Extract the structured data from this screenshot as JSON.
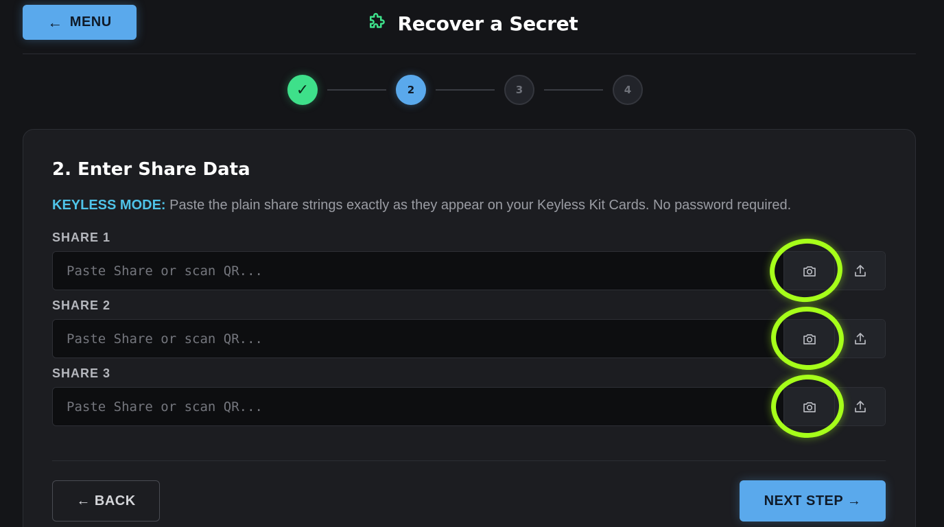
{
  "header": {
    "menu_arrow": "←",
    "menu_label": "MENU",
    "title": "Recover a Secret",
    "title_icon": "puzzle-icon"
  },
  "stepper": {
    "steps": [
      {
        "label": "✓",
        "state": "done"
      },
      {
        "label": "2",
        "state": "active"
      },
      {
        "label": "3",
        "state": "upcoming"
      },
      {
        "label": "4",
        "state": "upcoming"
      }
    ]
  },
  "card": {
    "title": "2. Enter Share Data",
    "mode_tag": "KEYLESS MODE:",
    "mode_text": " Paste the plain share strings exactly as they appear on your Keyless Kit Cards. No password required.",
    "shares": [
      {
        "label": "SHARE 1",
        "placeholder": "Paste Share or scan QR...",
        "value": ""
      },
      {
        "label": "SHARE 2",
        "placeholder": "Paste Share or scan QR...",
        "value": ""
      },
      {
        "label": "SHARE 3",
        "placeholder": "Paste Share or scan QR...",
        "value": ""
      }
    ],
    "back_label": "← BACK",
    "next_label": "NEXT STEP →"
  },
  "colors": {
    "accent": "#5aa9ec",
    "success": "#3ee08a",
    "mode_tag": "#4fc3e8",
    "highlight": "#a6ff1a",
    "background": "#141518",
    "card": "#1c1d21"
  }
}
